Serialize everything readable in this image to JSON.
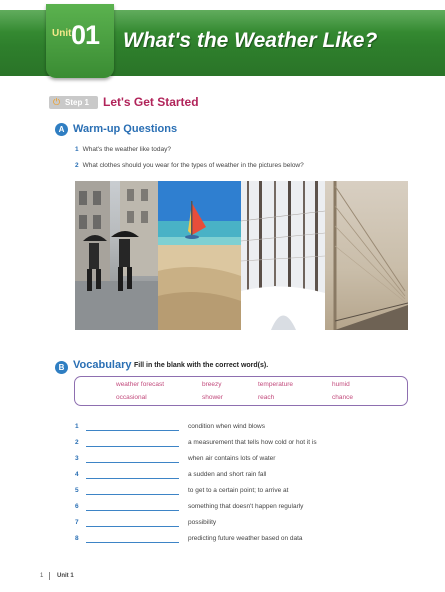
{
  "header": {
    "unit_word": "Unit",
    "unit_number": "01",
    "title": "What's the Weather Like?"
  },
  "step": {
    "label": "Step 1",
    "title": "Let's Get Started"
  },
  "warmup": {
    "title": "Warm-up Questions",
    "questions": [
      {
        "num": "1",
        "text": "What's the weather like today?"
      },
      {
        "num": "2",
        "text": "What clothes should you wear for the types of weather in the pictures below?"
      }
    ]
  },
  "photos": [
    {
      "icon": "rainy-street-photo"
    },
    {
      "icon": "sunny-beach-photo"
    },
    {
      "icon": "snowy-forest-photo"
    },
    {
      "icon": "foggy-bridge-photo"
    }
  ],
  "vocabulary": {
    "title": "Vocabulary",
    "instruction": "Fill in the blank with the correct word(s).",
    "words_row1": [
      "weather forecast",
      "breezy",
      "temperature",
      "humid"
    ],
    "words_row2": [
      "occasional",
      "shower",
      "reach",
      "chance"
    ],
    "items": [
      {
        "num": "1",
        "definition": "condition when wind blows"
      },
      {
        "num": "2",
        "definition": "a measurement that tells how cold or hot it is"
      },
      {
        "num": "3",
        "definition": "when air contains lots of water"
      },
      {
        "num": "4",
        "definition": "a sudden and short rain fall"
      },
      {
        "num": "5",
        "definition": "to get to a certain point; to arrive at"
      },
      {
        "num": "6",
        "definition": "something that doesn't happen regularly"
      },
      {
        "num": "7",
        "definition": "possibility"
      },
      {
        "num": "8",
        "definition": "predicting future weather based on data"
      }
    ]
  },
  "footer": {
    "page_number": "1",
    "unit_label": "Unit 1"
  },
  "colors": {
    "banner_green": "#2e7f2c",
    "step_magenta": "#b1245a",
    "section_blue": "#2a6fb4",
    "word_pink": "#c24a7c",
    "box_purple": "#8e6fb0"
  }
}
